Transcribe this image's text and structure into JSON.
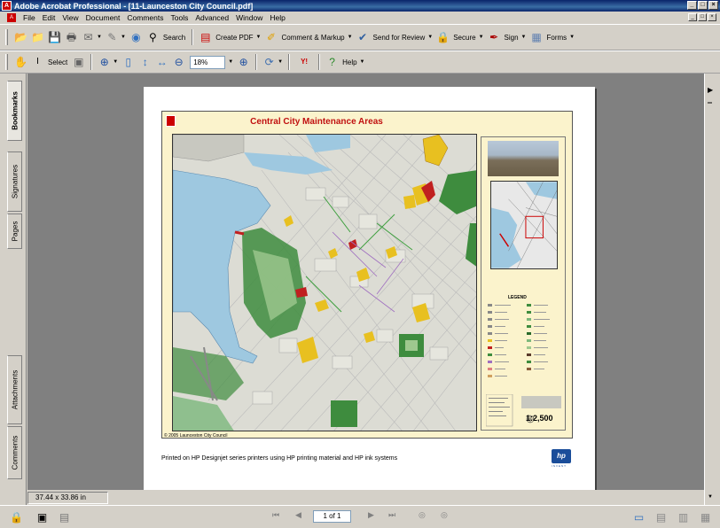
{
  "window": {
    "title": "Adobe Acrobat Professional - [11-Launceston City Council.pdf]",
    "icon": "acrobat-icon"
  },
  "menu": [
    "File",
    "Edit",
    "View",
    "Document",
    "Comments",
    "Tools",
    "Advanced",
    "Window",
    "Help"
  ],
  "toolbar1": {
    "search_label": "Search",
    "create_pdf_label": "Create PDF",
    "comment_markup_label": "Comment & Markup",
    "send_review_label": "Send for Review",
    "secure_label": "Secure",
    "sign_label": "Sign",
    "forms_label": "Forms"
  },
  "toolbar2": {
    "select_label": "Select",
    "zoom_value": "18%",
    "help_label": "Help"
  },
  "side_tabs": [
    "Bookmarks",
    "Signatures",
    "Pages",
    "Attachments",
    "Comments"
  ],
  "document": {
    "map_title": "Central City Maintenance Areas",
    "scale": "1:2,500",
    "footer_text": "Printed on HP Designjet series printers using HP printing material and HP ink systems",
    "hp_logo": "hp",
    "hp_tagline": "INVENT",
    "page_size": "37.44 x 33.86 in",
    "page_indicator": "1 of 1"
  },
  "colors": {
    "titlebar": "#0a246a",
    "map_title": "#c01010",
    "water": "#9ec8e0",
    "park": "#3e8c3e",
    "poster_bg": "#fbf3cc"
  }
}
